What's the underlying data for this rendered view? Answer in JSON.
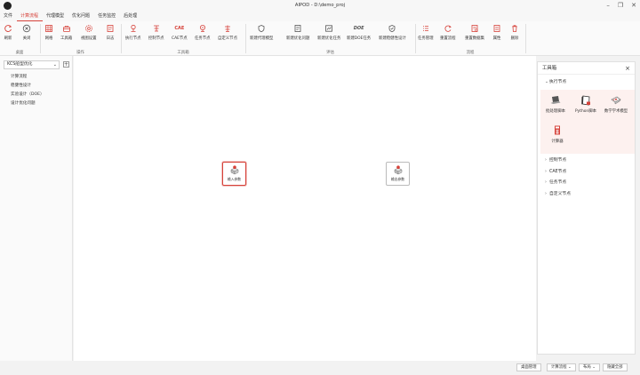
{
  "window": {
    "title": "AIPOD - D:\\demo_proj"
  },
  "menu": [
    "文件",
    "计算流程",
    "代理模型",
    "优化问题",
    "任务监控",
    "后处理"
  ],
  "ribbon": {
    "groups": [
      {
        "label": "桌面",
        "buttons": [
          "刷新",
          "关闭"
        ]
      },
      {
        "label": "操作",
        "buttons": [
          "网格",
          "工具箱",
          "视图设置",
          "日志"
        ]
      },
      {
        "label": "工具箱",
        "buttons": [
          "执行节点",
          "控制节点",
          "CAE节点",
          "任务节点",
          "自定义节点"
        ]
      },
      {
        "label": "评估",
        "buttons": [
          "新建代理模型",
          "新建优化问题",
          "新建优化任务",
          "新建DOE任务",
          "新建稳健性设计"
        ]
      },
      {
        "label": "流程",
        "buttons": [
          "任务管理",
          "重置流程",
          "重置数据集",
          "属性",
          "删除"
        ]
      }
    ],
    "icon_glyph_cae": "CAE",
    "icon_glyph_doe": "DOE"
  },
  "left_panel": {
    "project": "KCS船型优化",
    "tree": [
      "计算流程",
      "稳健性设计",
      "实验设计（DOE）",
      "设计优化问题"
    ]
  },
  "canvas": {
    "nodes": [
      {
        "label": "输入参数",
        "selected": true
      },
      {
        "label": "输出参数",
        "selected": false
      }
    ]
  },
  "toolbox": {
    "title": "工具箱",
    "expanded_section": "执行节点",
    "items": [
      "批处理脚本",
      "Python脚本",
      "数学学术模型",
      "计算器"
    ],
    "collapsed_sections": [
      "控制节点",
      "CAE节点",
      "任务节点",
      "自定义节点"
    ]
  },
  "status_bar": {
    "buttons": [
      "桌面管理",
      "计算流程",
      "布局",
      "隐藏全部"
    ]
  },
  "colors": {
    "accent": "#d6423a"
  }
}
